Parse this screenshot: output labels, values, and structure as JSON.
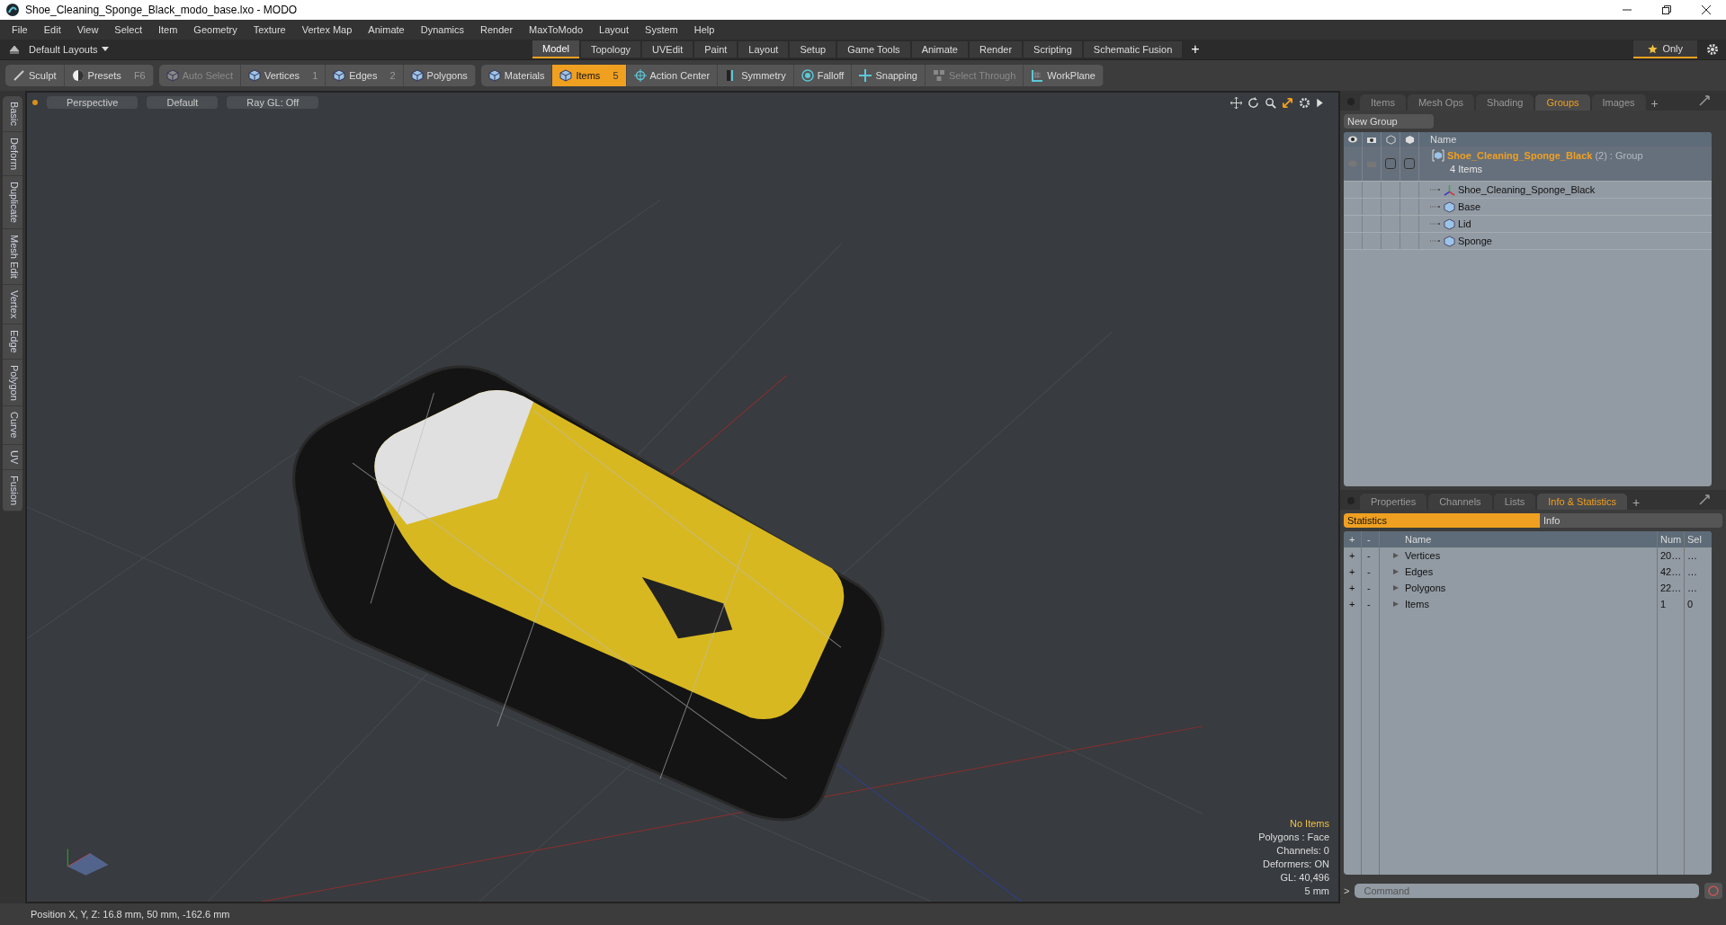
{
  "window": {
    "title": "Shoe_Cleaning_Sponge_Black_modo_base.lxo - MODO"
  },
  "menu": [
    "File",
    "Edit",
    "View",
    "Select",
    "Item",
    "Geometry",
    "Texture",
    "Vertex Map",
    "Animate",
    "Dynamics",
    "Render",
    "MaxToModo",
    "Layout",
    "System",
    "Help"
  ],
  "layout_bar": {
    "layout_menu": "Default Layouts",
    "tabs": [
      {
        "label": "Model",
        "selected": true
      },
      {
        "label": "Topology",
        "selected": false
      },
      {
        "label": "UVEdit",
        "selected": false
      },
      {
        "label": "Paint",
        "selected": false
      },
      {
        "label": "Layout",
        "selected": false
      },
      {
        "label": "Setup",
        "selected": false
      },
      {
        "label": "Game Tools",
        "selected": false
      },
      {
        "label": "Animate",
        "selected": false
      },
      {
        "label": "Render",
        "selected": false
      },
      {
        "label": "Scripting",
        "selected": false
      },
      {
        "label": "Schematic Fusion",
        "selected": false
      }
    ],
    "add": "+",
    "only": "Only"
  },
  "toolbar": [
    {
      "kind": "sculpt",
      "label": "Sculpt",
      "selected": false,
      "disabled": false
    },
    {
      "kind": "presets",
      "label": "Presets",
      "shortcut": "F6",
      "selected": false,
      "disabled": false
    },
    {
      "kind": "cube",
      "label": "Auto Select",
      "selected": false,
      "disabled": true
    },
    {
      "kind": "cube",
      "label": "Vertices",
      "shortcut": "1",
      "selected": false,
      "disabled": false
    },
    {
      "kind": "cube",
      "label": "Edges",
      "shortcut": "2",
      "selected": false,
      "disabled": false
    },
    {
      "kind": "cube",
      "label": "Polygons",
      "selected": false,
      "disabled": false
    },
    {
      "kind": "cube",
      "label": "Materials",
      "selected": false,
      "disabled": false
    },
    {
      "kind": "cube",
      "label": "Items",
      "shortcut": "5",
      "selected": true,
      "disabled": false
    },
    {
      "kind": "target",
      "label": "Action Center",
      "selected": false,
      "disabled": false
    },
    {
      "kind": "symmetry",
      "label": "Symmetry",
      "selected": false,
      "disabled": false
    },
    {
      "kind": "falloff",
      "label": "Falloff",
      "selected": false,
      "disabled": false
    },
    {
      "kind": "snap",
      "label": "Snapping",
      "selected": false,
      "disabled": false
    },
    {
      "kind": "through",
      "label": "Select Through",
      "selected": false,
      "disabled": true
    },
    {
      "kind": "workplane",
      "label": "WorkPlane",
      "selected": false,
      "disabled": false
    }
  ],
  "side_tabs": [
    "Basic",
    "Deform",
    "Duplicate",
    "Mesh Edit",
    "Vertex",
    "Edge",
    "Polygon",
    "Curve",
    "UV",
    "Fusion"
  ],
  "viewport": {
    "buttons": [
      "Perspective",
      "Default",
      "Ray GL: Off"
    ],
    "info": [
      {
        "text": "No Items",
        "highlight": true
      },
      {
        "text": "Polygons : Face",
        "highlight": false
      },
      {
        "text": "Channels: 0",
        "highlight": false
      },
      {
        "text": "Deformers: ON",
        "highlight": false
      },
      {
        "text": "GL: 40,496",
        "highlight": false
      },
      {
        "text": "5 mm",
        "highlight": false
      }
    ]
  },
  "groups_panel": {
    "tabs": [
      {
        "label": "Items",
        "selected": false
      },
      {
        "label": "Mesh Ops",
        "selected": false
      },
      {
        "label": "Shading",
        "selected": false
      },
      {
        "label": "Groups",
        "selected": true
      },
      {
        "label": "Images",
        "selected": false
      }
    ],
    "add": "+",
    "new_group": "New Group",
    "name_column": "Name",
    "group": {
      "flags": [
        {
          "checked": false
        },
        {
          "checked": false
        }
      ],
      "name": "Shoe_Cleaning_Sponge_Black",
      "count": "(2)",
      "type": ": Group",
      "subtitle": "4 Items",
      "children": [
        {
          "name": "Shoe_Cleaning_Sponge_Black",
          "kind": "locator"
        },
        {
          "name": "Base",
          "kind": "mesh"
        },
        {
          "name": "Lid",
          "kind": "mesh"
        },
        {
          "name": "Sponge",
          "kind": "mesh"
        }
      ]
    }
  },
  "stats_panel": {
    "tabs": [
      {
        "label": "Properties",
        "selected": false
      },
      {
        "label": "Channels",
        "selected": false
      },
      {
        "label": "Lists",
        "selected": false
      },
      {
        "label": "Info & Statistics",
        "selected": true
      }
    ],
    "add": "+",
    "subtabs": [
      {
        "label": "Statistics",
        "selected": true
      },
      {
        "label": "Info",
        "selected": false
      }
    ],
    "columns": [
      "+",
      "-",
      "Name",
      "Num",
      "Sel"
    ],
    "rows": [
      {
        "add": "+",
        "remove": "-",
        "name": "Vertices",
        "num": "20…",
        "sel": "…"
      },
      {
        "add": "+",
        "remove": "-",
        "name": "Edges",
        "num": "42…",
        "sel": "…"
      },
      {
        "add": "+",
        "remove": "-",
        "name": "Polygons",
        "num": "22…",
        "sel": "…"
      },
      {
        "add": "+",
        "remove": "-",
        "name": "Items",
        "num": "1",
        "sel": "0"
      }
    ]
  },
  "command": {
    "prompt": ">",
    "placeholder": "Command"
  },
  "status_bar": {
    "position": "Position X, Y, Z:  16.8 mm, 50 mm, -162.6 mm"
  }
}
